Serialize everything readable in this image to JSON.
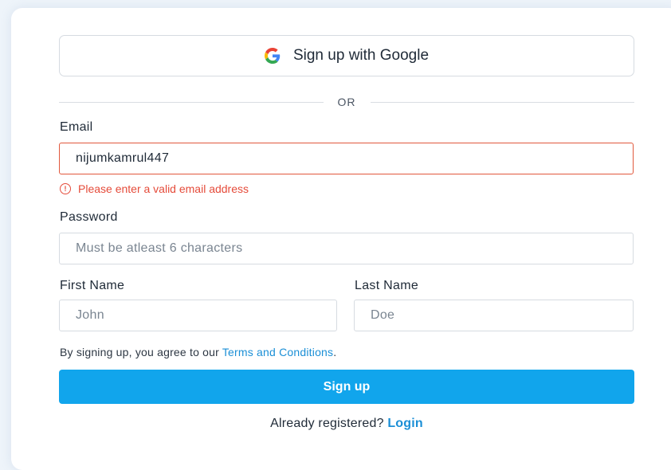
{
  "google_button": {
    "label": "Sign up with Google",
    "icon": "google-g-icon"
  },
  "divider": {
    "text": "OR"
  },
  "email": {
    "label": "Email",
    "value": "nijumkamrul447",
    "placeholder": "",
    "error_text": "Please enter a valid email address",
    "error_icon": "info-circle-icon"
  },
  "password": {
    "label": "Password",
    "value": "",
    "placeholder": "Must be atleast 6 characters"
  },
  "first_name": {
    "label": "First Name",
    "value": "",
    "placeholder": "John"
  },
  "last_name": {
    "label": "Last Name",
    "value": "",
    "placeholder": "Doe"
  },
  "terms": {
    "prefix": "By signing up, you agree to our ",
    "link": "Terms and Conditions",
    "suffix": "."
  },
  "signup_button": {
    "label": "Sign up"
  },
  "login_prompt": {
    "text": "Already registered? ",
    "link": "Login"
  },
  "colors": {
    "accent": "#11a5ec",
    "link": "#1b8fd6",
    "error": "#e54b3a"
  }
}
